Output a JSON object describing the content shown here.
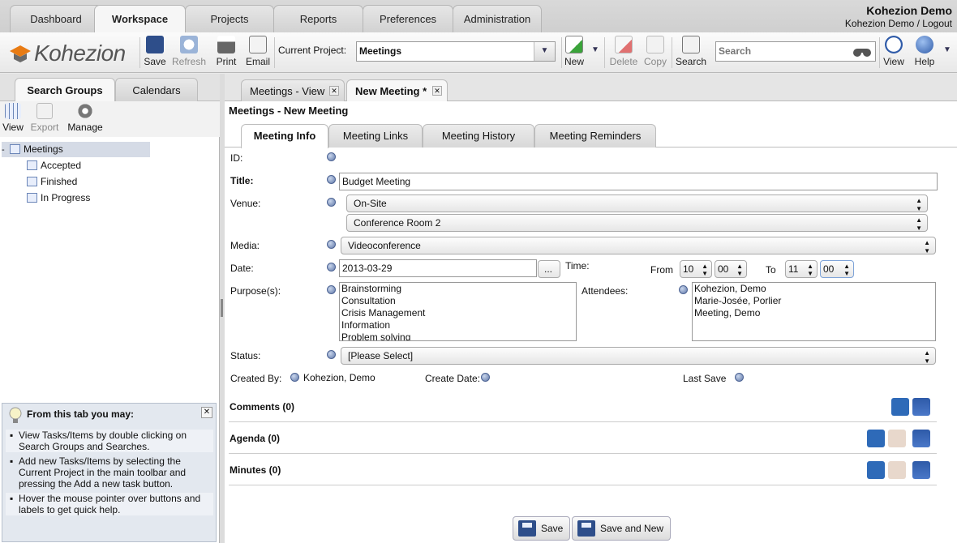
{
  "top_tabs": [
    "Dashboard",
    "Workspace",
    "Projects",
    "Reports",
    "Preferences",
    "Administration"
  ],
  "user": {
    "name": "Kohezion Demo",
    "links": "Kohezion Demo / Logout"
  },
  "logo": {
    "brand": "Kohezion",
    "accent_color": "#e87b13"
  },
  "toolbar": {
    "save": "Save",
    "refresh": "Refresh",
    "print": "Print",
    "email": "Email",
    "current_project_label": "Current Project:",
    "current_project_value": "Meetings",
    "new": "New",
    "delete": "Delete",
    "copy": "Copy",
    "search": "Search",
    "search_placeholder": "Search",
    "view": "View",
    "help": "Help"
  },
  "left": {
    "tabs": [
      "Search Groups",
      "Calendars"
    ],
    "tools": {
      "view": "View",
      "export": "Export",
      "manage": "Manage"
    },
    "tree": {
      "root": "Meetings",
      "children": [
        "Accepted",
        "Finished",
        "In Progress"
      ]
    },
    "help": {
      "title": "From this tab you may:",
      "items": [
        "View Tasks/Items by double clicking on Search Groups and Searches.",
        "Add new Tasks/Items by selecting the Current Project in the main toolbar and pressing the Add a new task button.",
        "Hover the mouse pointer over buttons and labels to get quick help."
      ]
    }
  },
  "doc_tabs": [
    "Meetings - View",
    "New Meeting *"
  ],
  "page_title": "Meetings - New Meeting",
  "form_tabs": [
    "Meeting Info",
    "Meeting Links",
    "Meeting History",
    "Meeting Reminders"
  ],
  "form": {
    "id_label": "ID:",
    "title_label": "Title:",
    "title_value": "Budget Meeting",
    "venue_label": "Venue:",
    "venue_value": "On-Site",
    "room_value": "Conference Room 2",
    "media_label": "Media:",
    "media_value": "Videoconference",
    "date_label": "Date:",
    "date_value": "2013-03-29",
    "date_btn": "...",
    "time_label": "Time:",
    "from_label": "From",
    "from_h": "10",
    "from_m": "00",
    "to_label": "To",
    "to_h": "11",
    "to_m": "00",
    "purpose_label": "Purpose(s):",
    "purposes": [
      "Brainstorming",
      "Consultation",
      "Crisis Management",
      "Information",
      "Problem solving"
    ],
    "attendees_label": "Attendees:",
    "attendees": [
      "Kohezion, Demo",
      "Marie-Josée, Porlier",
      "Meeting, Demo"
    ],
    "status_label": "Status:",
    "status_value": "[Please Select]",
    "created_by_label": "Created By:",
    "created_by_value": "Kohezion, Demo",
    "create_date_label": "Create Date:",
    "last_save_label": "Last Save"
  },
  "sections": [
    "Comments (0)",
    "Agenda (0)",
    "Minutes (0)"
  ],
  "buttons": {
    "save": "Save",
    "save_new": "Save and New"
  }
}
